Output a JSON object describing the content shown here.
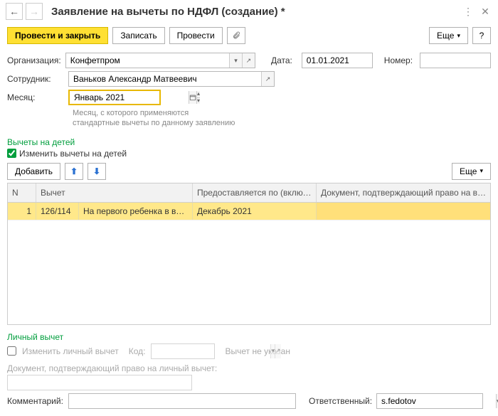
{
  "window": {
    "title": "Заявление на вычеты по НДФЛ (создание) *"
  },
  "toolbar": {
    "post_close": "Провести и закрыть",
    "save": "Записать",
    "post": "Провести",
    "more": "Еще"
  },
  "form": {
    "org_label": "Организация:",
    "org_value": "Конфетпром",
    "date_label": "Дата:",
    "date_value": "01.01.2021",
    "number_label": "Номер:",
    "number_value": "",
    "employee_label": "Сотрудник:",
    "employee_value": "Ваньков Александр Матвеевич",
    "month_label": "Месяц:",
    "month_value": "Январь 2021",
    "month_hint1": "Месяц, с которого применяются",
    "month_hint2": "стандартные вычеты по данному заявлению"
  },
  "children": {
    "section": "Вычеты на детей",
    "change_label": "Изменить вычеты на детей",
    "add": "Добавить",
    "more": "Еще",
    "cols": {
      "n": "N",
      "deduction": "Вычет",
      "until": "Предоставляется по (включительно)",
      "doc": "Документ, подтверждающий право на вычет"
    },
    "rows": [
      {
        "n": "1",
        "code": "126/114",
        "desc": "На первого ребенка в возр...",
        "until": "Декабрь 2021",
        "doc": ""
      }
    ]
  },
  "personal": {
    "section": "Личный вычет",
    "change_label": "Изменить личный вычет",
    "code_label": "Код:",
    "code_value": "",
    "not_specified": "Вычет не указан",
    "doc_label": "Документ, подтверждающий право на личный вычет:",
    "doc_value": ""
  },
  "footer": {
    "comment_label": "Комментарий:",
    "comment_value": "",
    "responsible_label": "Ответственный:",
    "responsible_value": "s.fedotov"
  }
}
